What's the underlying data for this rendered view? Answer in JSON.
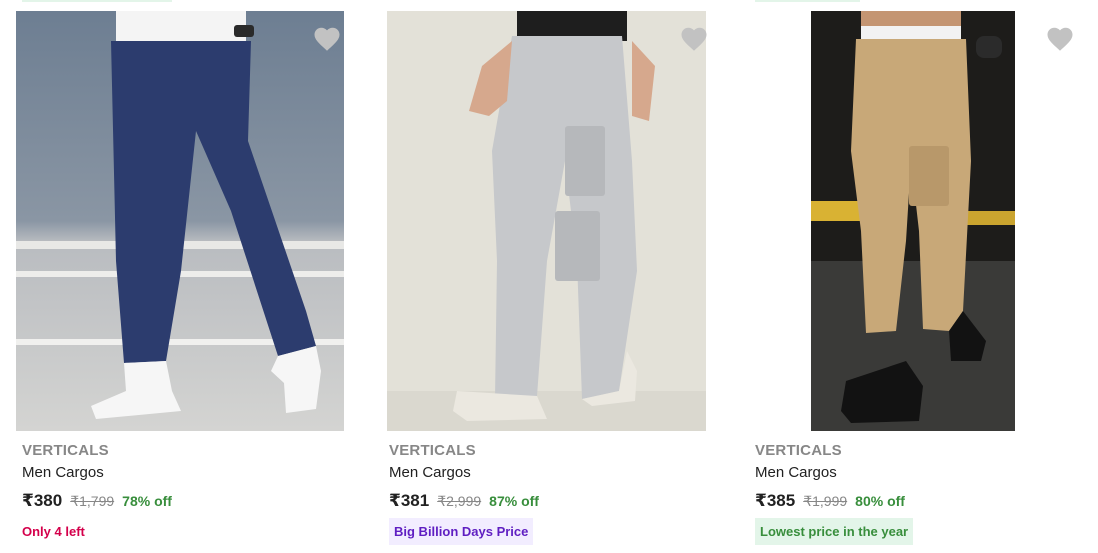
{
  "colors": {
    "brand_gray": "#878787",
    "discount_green": "#388e3c",
    "scarcity_pink": "#d4004b",
    "bbd_purple": "#5f1ec2",
    "bbd_bg": "#f2edff",
    "lowest_bg": "#e3f5e9",
    "wishlist_gray": "#c2c2c2"
  },
  "products": [
    {
      "brand": "VERTICALS",
      "title": "Men Cargos",
      "price": "₹380",
      "mrp": "₹1,799",
      "discount": "78% off",
      "tag": "Only 4 left",
      "wishlist_icon": "heart-icon"
    },
    {
      "brand": "VERTICALS",
      "title": "Men Cargos",
      "price": "₹381",
      "mrp": "₹2,999",
      "discount": "87% off",
      "tag": "Big Billion Days Price",
      "wishlist_icon": "heart-icon"
    },
    {
      "brand": "VERTICALS",
      "title": "Men Cargos",
      "price": "₹385",
      "mrp": "₹1,999",
      "discount": "80% off",
      "tag": "Lowest price in the year",
      "wishlist_icon": "heart-icon"
    }
  ]
}
